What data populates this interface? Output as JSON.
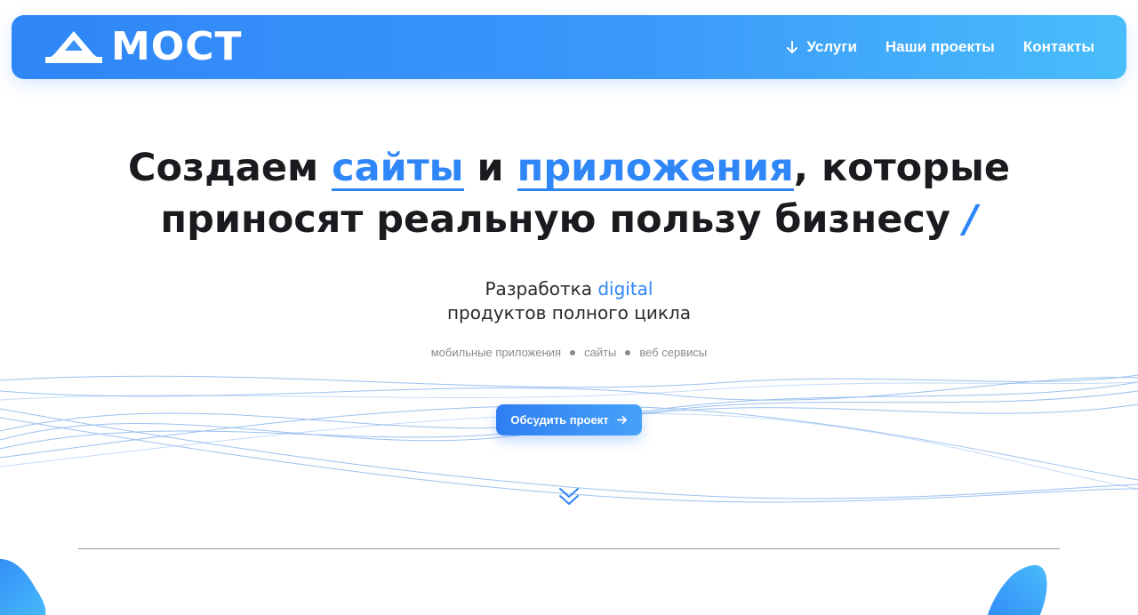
{
  "header": {
    "logo_text": "МОСТ",
    "nav": [
      {
        "label": "Услуги",
        "icon": "arrow-down-icon"
      },
      {
        "label": "Наши проекты"
      },
      {
        "label": "Контакты"
      }
    ]
  },
  "hero": {
    "title": {
      "part1": "Создаем ",
      "highlight1": "сайты",
      "part2": " и ",
      "highlight2": "приложения",
      "part3": ", которые",
      "line2": "приносят реальную пользу бизнесу ",
      "slash": "/"
    },
    "subtitle": {
      "prefix": "Разработка ",
      "accent": "digital",
      "line2": "продуктов полного цикла"
    },
    "tags": [
      "мобильные приложения",
      "сайты",
      "веб сервисы"
    ],
    "cta_label": "Обсудить проект"
  },
  "colors": {
    "brand": "#2f86f7",
    "brand_light": "#49bdfb",
    "text": "#1b1b1f",
    "muted": "#8a8a90"
  }
}
